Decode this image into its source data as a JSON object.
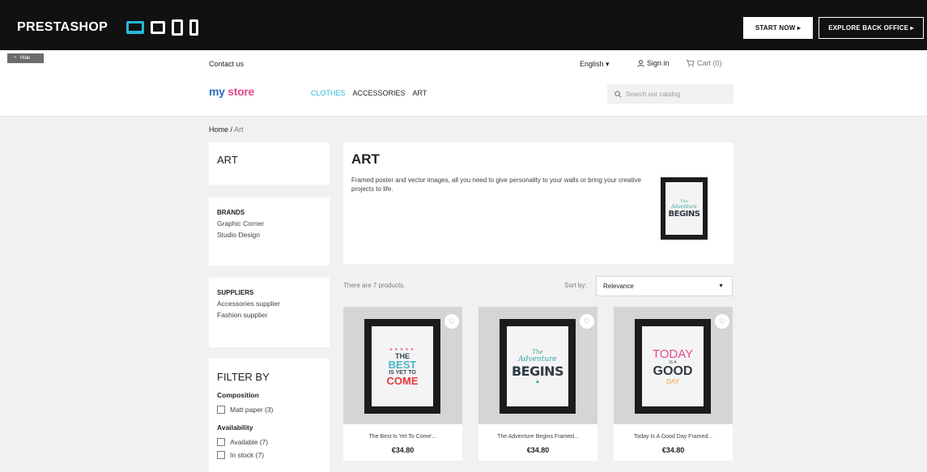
{
  "topbar": {
    "brand": "PRESTASHOP",
    "start_label": "START NOW ▸",
    "explore_label": "EXPLORE BACK OFFICE ▸",
    "hide_label": "Hide"
  },
  "header": {
    "contact": "Contact us",
    "language": "English ▾",
    "signin": "Sign in",
    "cart": "Cart (0)",
    "logo_my": "my",
    "logo_store": "store",
    "nav": [
      "CLOTHES",
      "ACCESSORIES",
      "ART"
    ],
    "search_placeholder": "Search our catalog"
  },
  "breadcrumb": {
    "home": "Home",
    "sep": "/",
    "current": "Art"
  },
  "sidebar": {
    "category_title": "ART",
    "brands_heading": "BRANDS",
    "brands": [
      "Graphic Corner",
      "Studio Design"
    ],
    "suppliers_heading": "SUPPLIERS",
    "suppliers": [
      "Accessories supplier",
      "Fashion supplier"
    ],
    "filter_title": "FILTER BY",
    "composition_heading": "Composition",
    "composition_options": [
      "Matt paper (3)"
    ],
    "availability_heading": "Availability",
    "availability_options": [
      "Available (7)",
      "In stock (7)"
    ]
  },
  "category": {
    "title": "ART",
    "description": "Framed poster and vector images, all you need to give personality to your walls or bring your creative projects to life.",
    "poster_line1": "The",
    "poster_line2": "Adventure",
    "poster_line3": "BEGINS"
  },
  "listing": {
    "count_text": "There are 7 products.",
    "sort_label": "Sort by:",
    "sort_value": "Relevance",
    "products": [
      {
        "name": "The Best Is Yet To Come'...",
        "price": "€34.80",
        "poster": [
          "THE",
          "BEST",
          "IS YET TO",
          "COME"
        ]
      },
      {
        "name": "The Adventure Begins Framed...",
        "price": "€34.80",
        "poster": [
          "The",
          "Adventure",
          "BEGINS"
        ]
      },
      {
        "name": "Today Is A Good Day Framed...",
        "price": "€34.80",
        "poster": [
          "TODAY",
          "IS A",
          "GOOD",
          "DAY"
        ]
      }
    ]
  },
  "colors": {
    "accent": "#25b9d7",
    "topbar": "#111111",
    "logo_blue": "#2e6db8",
    "logo_pink": "#e24b8d"
  }
}
